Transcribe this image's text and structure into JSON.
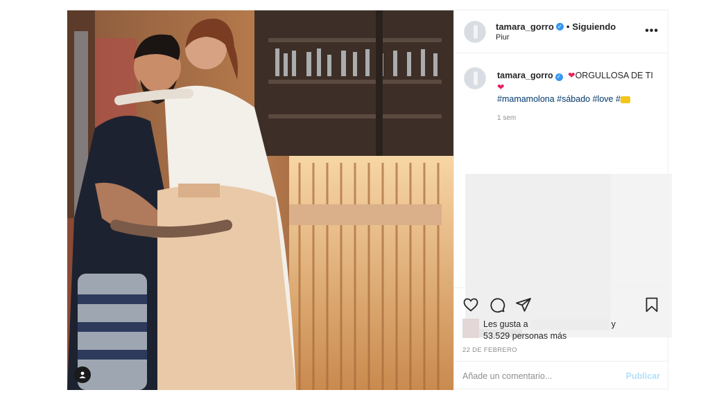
{
  "post": {
    "username": "tamara_gorro",
    "following": "Siguiendo",
    "separator": "•",
    "location": "Piur",
    "more_label": "•••"
  },
  "caption": {
    "username": "tamara_gorro",
    "text_1": "ORGULLOSA DE TI",
    "hashtags": "#mamamolona #sábado #love #",
    "time": "1 sem"
  },
  "likes": {
    "prefix": "Les gusta a",
    "connector": "y",
    "count_text": "53.529 personas más"
  },
  "date": "22 DE FEBRERO",
  "comment_box": {
    "placeholder": "Añade un comentario...",
    "publish": "Publicar"
  },
  "icons": {
    "like": "heart-outline-icon",
    "comment": "comment-bubble-icon",
    "share": "paper-plane-icon",
    "save": "bookmark-icon",
    "tag": "user-tag-icon",
    "verified": "verified-badge-icon"
  }
}
